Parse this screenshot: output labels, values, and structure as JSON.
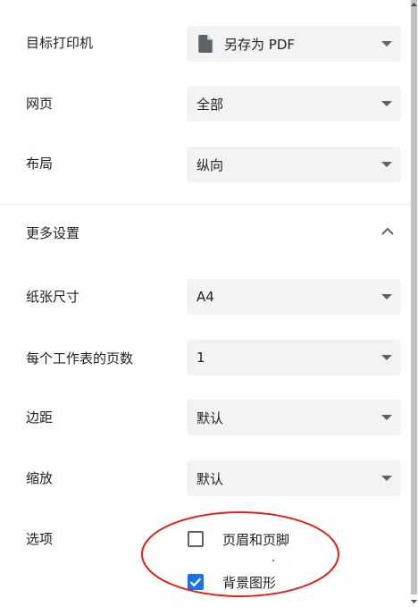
{
  "destination": {
    "label": "目标打印机",
    "value": "另存为 PDF",
    "icon": "pdf-file-icon"
  },
  "pages": {
    "label": "网页",
    "value": "全部"
  },
  "layout": {
    "label": "布局",
    "value": "纵向"
  },
  "more_settings": {
    "label": "更多设置",
    "expanded": true
  },
  "paper_size": {
    "label": "纸张尺寸",
    "value": "A4"
  },
  "pages_per_sheet": {
    "label": "每个工作表的页数",
    "value": "1"
  },
  "margins": {
    "label": "边距",
    "value": "默认"
  },
  "scale": {
    "label": "缩放",
    "value": "默认"
  },
  "options": {
    "label": "选项",
    "headers_footers": {
      "label": "页眉和页脚",
      "checked": false
    },
    "background_graphics": {
      "label": "背景图形",
      "checked": true
    }
  },
  "colors": {
    "accent": "#1a73e8",
    "annotation": "#e0201c"
  }
}
